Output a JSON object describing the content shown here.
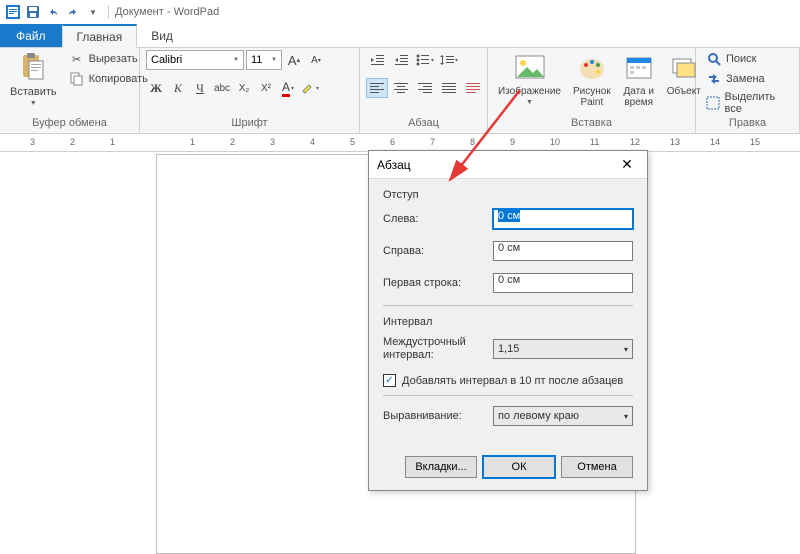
{
  "titlebar": {
    "title": "Документ - WordPad"
  },
  "tabs": {
    "file": "Файл",
    "home": "Главная",
    "view": "Вид"
  },
  "clipboard": {
    "label": "Буфер обмена",
    "paste": "Вставить",
    "cut": "Вырезать",
    "copy": "Копировать"
  },
  "font": {
    "label": "Шрифт",
    "name": "Calibri",
    "size": "11"
  },
  "paragraph": {
    "label": "Абзац"
  },
  "insert": {
    "label": "Вставка",
    "image": "Изображение",
    "paint": "Рисунок Paint",
    "datetime": "Дата и время",
    "object": "Объект"
  },
  "edit": {
    "label": "Правка",
    "find": "Поиск",
    "replace": "Замена",
    "selectall": "Выделить все"
  },
  "ruler": [
    "3",
    "2",
    "1",
    "",
    "1",
    "2",
    "3",
    "4",
    "5",
    "6",
    "7",
    "8",
    "9",
    "10",
    "11",
    "12",
    "13",
    "14",
    "15"
  ],
  "dialog": {
    "title": "Абзац",
    "indent_label": "Отступ",
    "left_label": "Слева:",
    "left_value": "0 см",
    "right_label": "Справа:",
    "right_value": "0 см",
    "firstline_label": "Первая строка:",
    "firstline_value": "0 см",
    "spacing_label": "Интервал",
    "linespacing_label": "Междустрочный интервал:",
    "linespacing_value": "1,15",
    "addspace_label": "Добавлять интервал в 10 пт после абзацев",
    "addspace_checked": true,
    "align_label": "Выравнивание:",
    "align_value": "по левому краю",
    "tabs_btn": "Вкладки...",
    "ok_btn": "ОК",
    "cancel_btn": "Отмена"
  }
}
